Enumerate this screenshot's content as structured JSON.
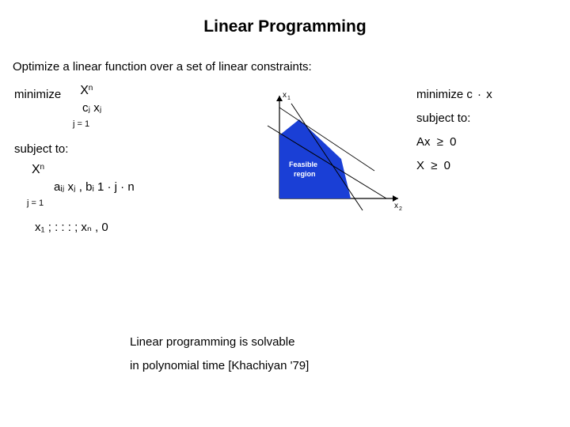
{
  "title": "Linear Programming",
  "subtitle": "Optimize a linear function over a set of linear constraints:",
  "left": {
    "minimize": "minimize",
    "sum_upper": "n",
    "obj_term": "cⱼ xⱼ",
    "sum_lower": "j = 1",
    "subject_to": "subject to:",
    "constraint_term": "aᵢⱼ xⱼ ,  bᵢ    1 ·  j ·  n",
    "sum_lower2": "j = 1",
    "nonneg": "x₁ ; : : : ; xₙ ,   0"
  },
  "right": {
    "minimize": "minimize   c",
    "dot": "·",
    "x": "x",
    "subject_to": "subject to:",
    "axge": "Ax",
    "ge": "≥",
    "zero": "0",
    "Xge": "X",
    "zero2": "0"
  },
  "diagram": {
    "x1_label": "x₁",
    "x2_label": "x₂",
    "feasible_label": "Feasible\nregion"
  },
  "footer": {
    "line1": "Linear programming is solvable",
    "line2": "in polynomial time [Khachiyan '79]"
  }
}
